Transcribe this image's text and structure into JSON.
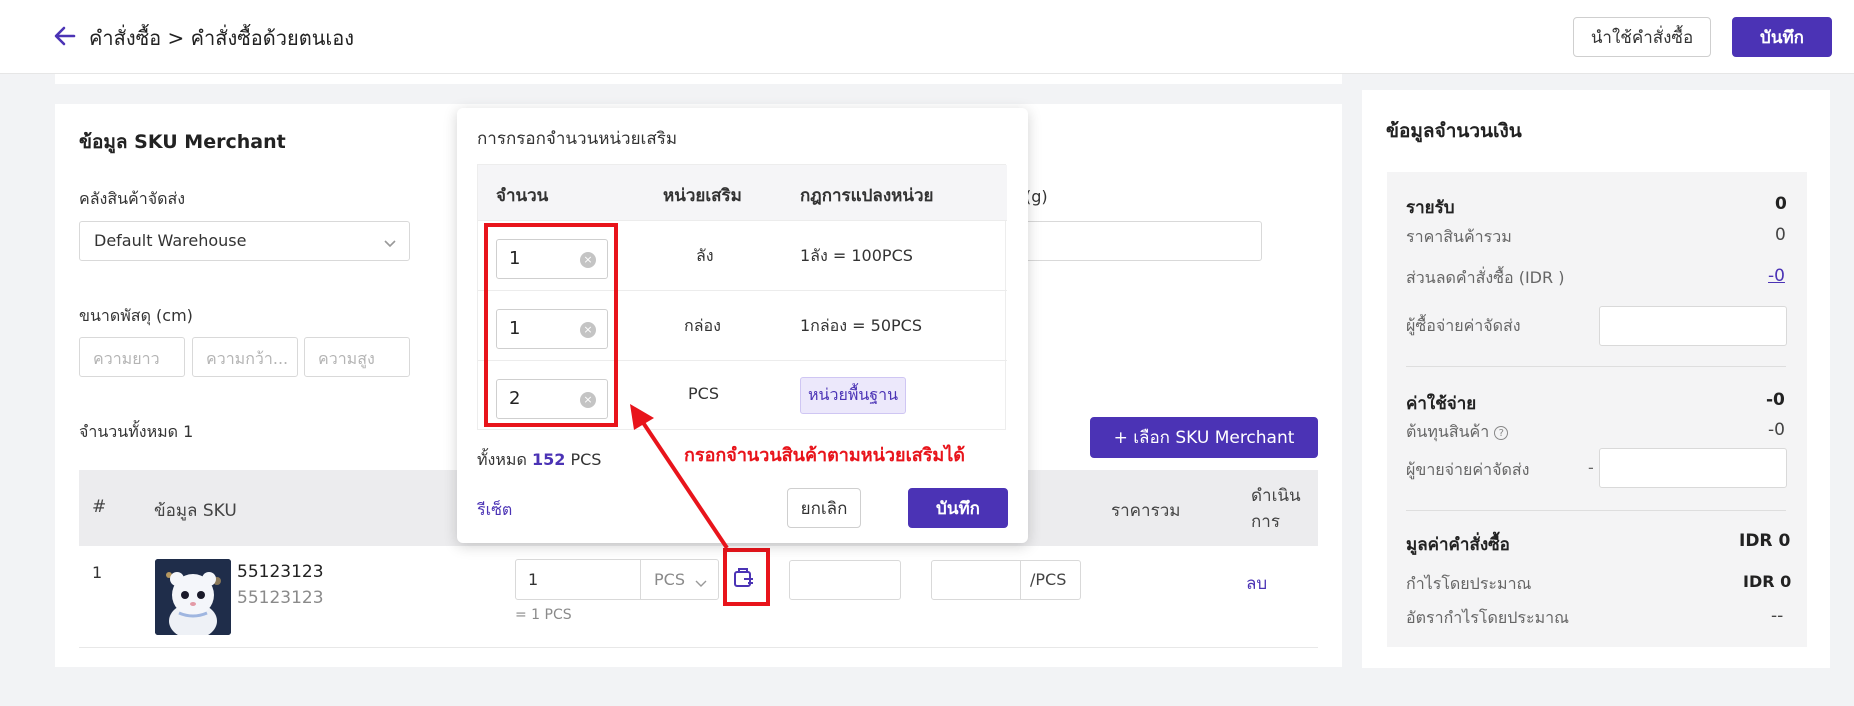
{
  "header": {
    "breadcrumb": "คำสั่งซื้อ > คำสั่งซื้อด้วยตนเอง",
    "import_label": "นำใช้คำสั่งซื้อ",
    "save_label": "บันทึก"
  },
  "sku_card": {
    "title": "ข้อมูล SKU Merchant",
    "warehouse_label": "คลังสินค้าจัดส่ง",
    "warehouse_value": "Default Warehouse",
    "weight_label_fragment": "(g)",
    "dims_label": "ขนาดพัสดุ (cm)",
    "dims_placeholders": [
      "ความยาว",
      "ความกว้า...",
      "ความสูง"
    ],
    "total_label": "จำนวนทั้งหมด 1",
    "select_button": "+ เลือก SKU Merchant",
    "table_headers": {
      "index": "#",
      "sku": "ข้อมูล SKU",
      "total_price": "ราคารวม",
      "action": "ดำเนิน การ"
    },
    "row": {
      "index": "1",
      "sku_name": "55123123",
      "sku_code": "55123123",
      "qty": "1",
      "unit": "PCS",
      "qty_note": "= 1 PCS",
      "price_unit": "/PCS",
      "delete_label": "ลบ"
    }
  },
  "popover": {
    "title": "การกรอกจำนวนหน่วยเสริม",
    "headers": {
      "qty": "จำนวน",
      "unit": "หน่วยเสริม",
      "rule": "กฎการแปลงหน่วย"
    },
    "rows": [
      {
        "qty": "1",
        "unit": "ลัง",
        "rule": "1ลัง = 100PCS"
      },
      {
        "qty": "1",
        "unit": "กล่อง",
        "rule": "1กล่อง = 50PCS"
      },
      {
        "qty": "2",
        "unit": "PCS",
        "rule": "หน่วยพื้นฐาน"
      }
    ],
    "total_prefix": "ทั้งหมด",
    "total_value": "152",
    "total_unit": "PCS",
    "reset_label": "รีเซ็ต",
    "cancel_label": "ยกเลิก",
    "save_label": "บันทึก"
  },
  "annotation": {
    "text": "กรอกจำนวนสินค้าตามหน่วยเสริมได้"
  },
  "amount_panel": {
    "title": "ข้อมูลจำนวนเงิน",
    "income_label": "รายรับ",
    "income_value": "0",
    "goods_total_label": "ราคาสินค้ารวม",
    "goods_total_value": "0",
    "discount_label": "ส่วนลดคำสั่งซื้อ (IDR )",
    "discount_value": "-0",
    "buyer_shipping_label": "ผู้ซื้อจ่ายค่าจัดส่ง",
    "expense_label": "ค่าใช้จ่าย",
    "expense_value": "-0",
    "cost_label": "ต้นทุนสินค้า",
    "cost_value": "-0",
    "seller_shipping_label": "ผู้ขายจ่ายค่าจัดส่ง",
    "seller_shipping_prefix": "-",
    "order_value_label": "มูลค่าคำสั่งซื้อ",
    "order_value": "IDR 0",
    "profit_label": "กำไรโดยประมาณ",
    "profit_value": "IDR 0",
    "margin_label": "อัตรากำไรโดยประมาณ",
    "margin_value": "--"
  },
  "colors": {
    "accent": "#4b33b5",
    "annotation": "#e8141b"
  },
  "icons": [
    "back-arrow-icon",
    "chevron-down-icon",
    "clear-icon",
    "unit-entry-icon",
    "help-icon"
  ]
}
